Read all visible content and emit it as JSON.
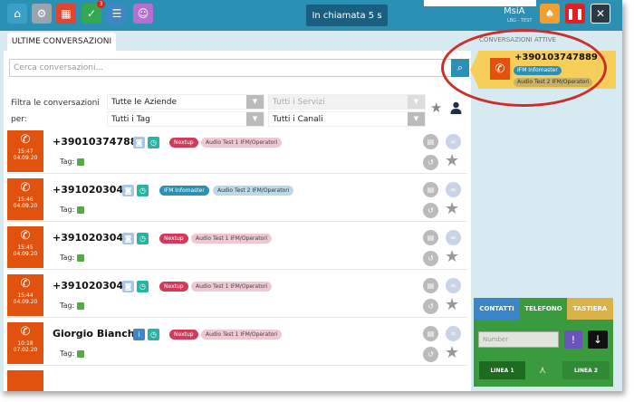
{
  "topbar": {
    "icons": [
      "home-icon",
      "gear-icon",
      "calendar-icon",
      "check-icon",
      "list-icon",
      "contacts-icon"
    ],
    "badge": "3",
    "call_status": "In chiamata  5 s",
    "user_name": "MsiA",
    "user_sub": "LBG - TEST",
    "colors": {
      "bar": "#2c8fb4",
      "pause": "#e02020",
      "bell": "#f0a030"
    }
  },
  "tabs": {
    "conversations": "ULTIME CONVERSAZIONI"
  },
  "search": {
    "placeholder": "Cerca conversazioni..."
  },
  "filters": {
    "label": "Filtra le conversazioni per:",
    "aziende": "Tutte le Aziende",
    "servizi": "Tutti i Servizi",
    "tag": "Tutti i Tag",
    "canali": "Tutti i Canali"
  },
  "rows": [
    {
      "time": "15:47",
      "date": "04.09.20",
      "number": "+390103747889",
      "tag_label": "Tag:",
      "pills": [
        {
          "text": "Nextup",
          "kind": "red"
        },
        {
          "text": "Audio Test 1 IFM/Operatori",
          "kind": "pink"
        }
      ]
    },
    {
      "time": "15:46",
      "date": "04.09.20",
      "number": "+3910203040",
      "tag_label": "Tag:",
      "pills": [
        {
          "text": "IFM Infomaster",
          "kind": "blue"
        },
        {
          "text": "Audio Test 2 IFM/Operatori",
          "kind": "lightblue"
        }
      ]
    },
    {
      "time": "15:45",
      "date": "04.09.20",
      "number": "+3910203040",
      "tag_label": "Tag:",
      "pills": [
        {
          "text": "Nextup",
          "kind": "red"
        },
        {
          "text": "Audio Test 1 IFM/Operatori",
          "kind": "pink"
        }
      ]
    },
    {
      "time": "15:44",
      "date": "04.09.20",
      "number": "+3910203040",
      "tag_label": "Tag:",
      "pills": [
        {
          "text": "Nextup",
          "kind": "red"
        },
        {
          "text": "Audio Test 1 IFM/Operatori",
          "kind": "pink"
        }
      ]
    },
    {
      "time": "10:18",
      "date": "07.02.20",
      "number": "Giorgio Bianchi",
      "tag_label": "Tag:",
      "pills": [
        {
          "text": "Nextup",
          "kind": "red"
        },
        {
          "text": "Audio Test 1 IFM/Operatori",
          "kind": "pink"
        }
      ]
    }
  ],
  "active": {
    "header": "CONVERSAZIONI ATTIVE",
    "number": "+390103747889",
    "company": "IFM Infomaster",
    "service": "Audio Test 2 IFM/Operatori"
  },
  "dialer": {
    "tabs": [
      "CONTATTI",
      "TELEFONO",
      "TASTIERA"
    ],
    "number_placeholder": "Number",
    "line1": "LINEA 1",
    "line2": "LINEA 2"
  }
}
